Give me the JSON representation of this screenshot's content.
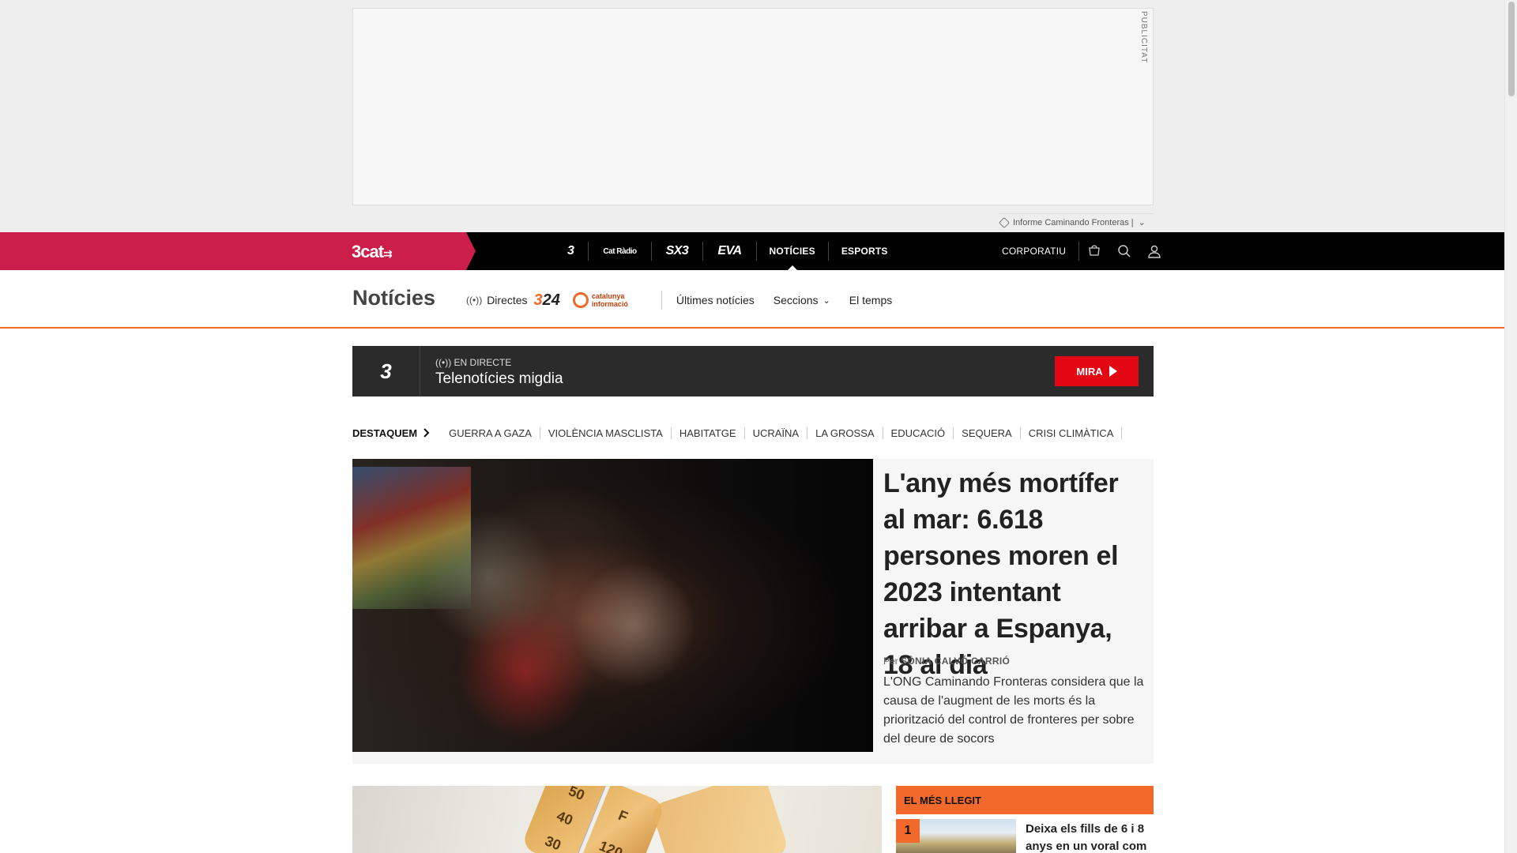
{
  "ad": {
    "label": "PUBLICITAT",
    "report": "Informe Caminando Fronteras |",
    "report_chevron": "⌄"
  },
  "topnav": {
    "brand": "3cat",
    "brand_arrow": "⇉",
    "channels": [
      "3",
      "Cat Ràdio",
      "SX3",
      "EVA"
    ],
    "links": [
      "NOTÍCIES",
      "ESPORTS"
    ],
    "corporate": "CORPORATIU",
    "icons": [
      "cart-icon",
      "search-icon",
      "user-icon"
    ]
  },
  "section": {
    "title": "Notícies",
    "directes": "Directes",
    "logo324_prefix": "3",
    "logo324_suffix": "24",
    "logocat": "catalunya informació",
    "items": [
      "Últimes notícies",
      "Seccions",
      "El temps"
    ],
    "chevron": "⌄"
  },
  "live": {
    "channel": "3",
    "label": "EN DIRECTE",
    "title": "Telenotícies migdia",
    "button": "MIRA"
  },
  "destaquem": {
    "label": "DESTAQUEM",
    "items": [
      "GUERRA A GAZA",
      "VIOLÈNCIA MASCLISTA",
      "HABITATGE",
      "UCRAÏNA",
      "LA GROSSA",
      "EDUCACIÓ",
      "SEQUERA",
      "CRISI CLIMÀTICA"
    ]
  },
  "feature": {
    "title": "L'any més mortífer al mar: 6.618 persones moren el 2023 intentant arribar a Espanya, 18 al dia",
    "author_prefix": "Per",
    "author": "SÒNIA CALVÓ CARRIÓ",
    "description": "L'ONG Caminando Fronteras considera que la causa de l'augment de les morts és la priorització del control de fronteres per sobre del deure de socors"
  },
  "second": {
    "thermo_numbers": [
      "50",
      "40",
      "30",
      "F",
      "120"
    ]
  },
  "mes_llegit": {
    "label": "EL MÉS LLEGIT",
    "items": [
      {
        "rank": "1",
        "title": "Deixa els fills de 6 i 8 anys en un voral com"
      }
    ]
  }
}
